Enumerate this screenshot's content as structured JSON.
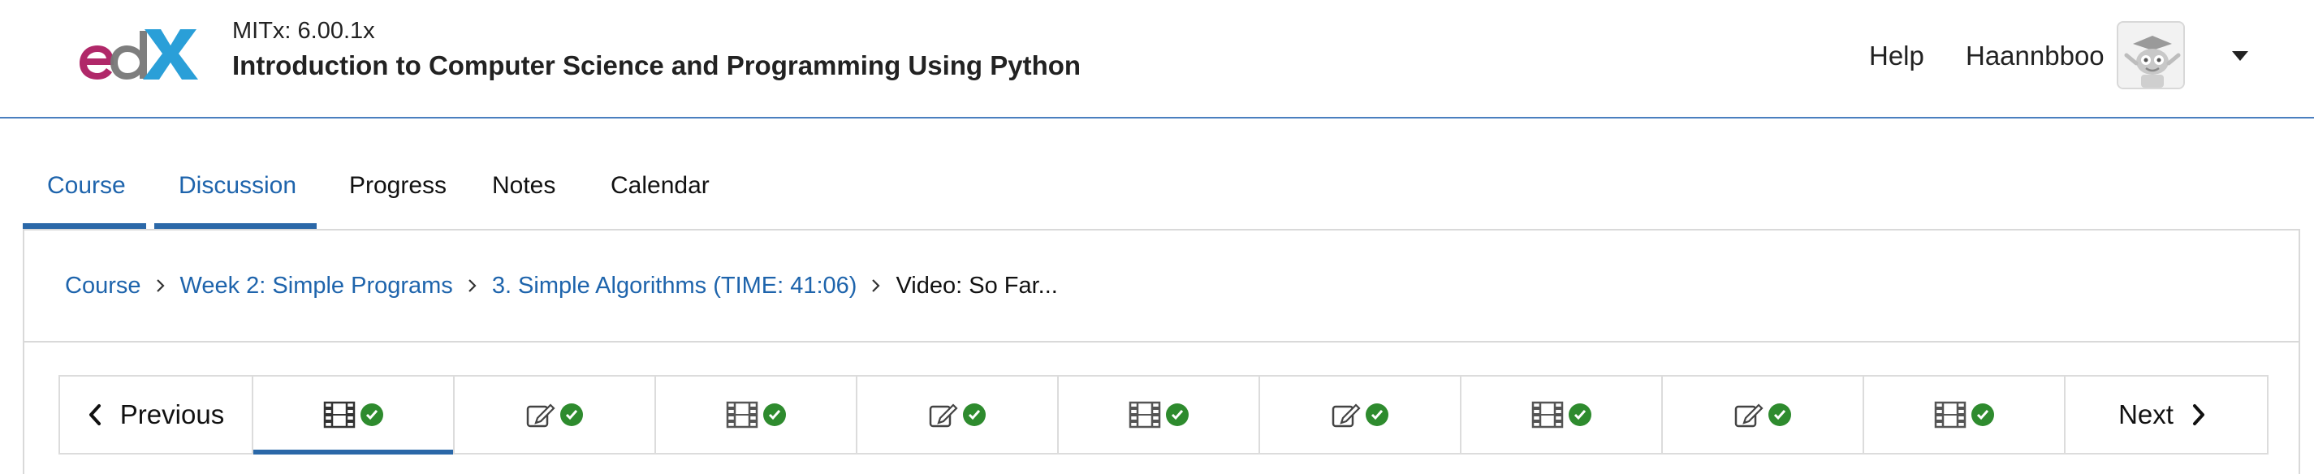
{
  "header": {
    "logo_text": "edX",
    "course_org": "MITx: 6.00.1x",
    "course_title": "Introduction to Computer Science and Programming Using Python",
    "help_label": "Help",
    "username": "Haannbboo",
    "avatar_icon": "user-avatar-icon",
    "menu_icon": "caret-down-icon"
  },
  "tabs": [
    {
      "label": "Course",
      "active": true
    },
    {
      "label": "Discussion",
      "active": true
    },
    {
      "label": "Progress",
      "active": false
    },
    {
      "label": "Notes",
      "active": false
    },
    {
      "label": "Calendar",
      "active": false
    }
  ],
  "breadcrumb": {
    "items": [
      "Course",
      "Week 2: Simple Programs",
      "3. Simple Algorithms (TIME: 41:06)"
    ],
    "current": "Video: So Far..."
  },
  "sequence": {
    "previous_label": "Previous",
    "next_label": "Next",
    "items": [
      {
        "type": "video",
        "icon": "film-icon",
        "completed": true,
        "active": true
      },
      {
        "type": "problem",
        "icon": "edit-icon",
        "completed": true,
        "active": false
      },
      {
        "type": "video",
        "icon": "film-icon",
        "completed": true,
        "active": false
      },
      {
        "type": "problem",
        "icon": "edit-icon",
        "completed": true,
        "active": false
      },
      {
        "type": "video",
        "icon": "film-icon",
        "completed": true,
        "active": false
      },
      {
        "type": "problem",
        "icon": "edit-icon",
        "completed": true,
        "active": false
      },
      {
        "type": "video",
        "icon": "film-icon",
        "completed": true,
        "active": false
      },
      {
        "type": "problem",
        "icon": "edit-icon",
        "completed": true,
        "active": false
      },
      {
        "type": "video",
        "icon": "film-icon",
        "completed": true,
        "active": false
      }
    ]
  },
  "colors": {
    "link_blue": "#1e64ac",
    "active_bar": "#2b68a8",
    "check_green": "#2e8b2e",
    "logo_magenta": "#b02869",
    "logo_gray": "#777777",
    "logo_blue": "#2a9fd8"
  }
}
